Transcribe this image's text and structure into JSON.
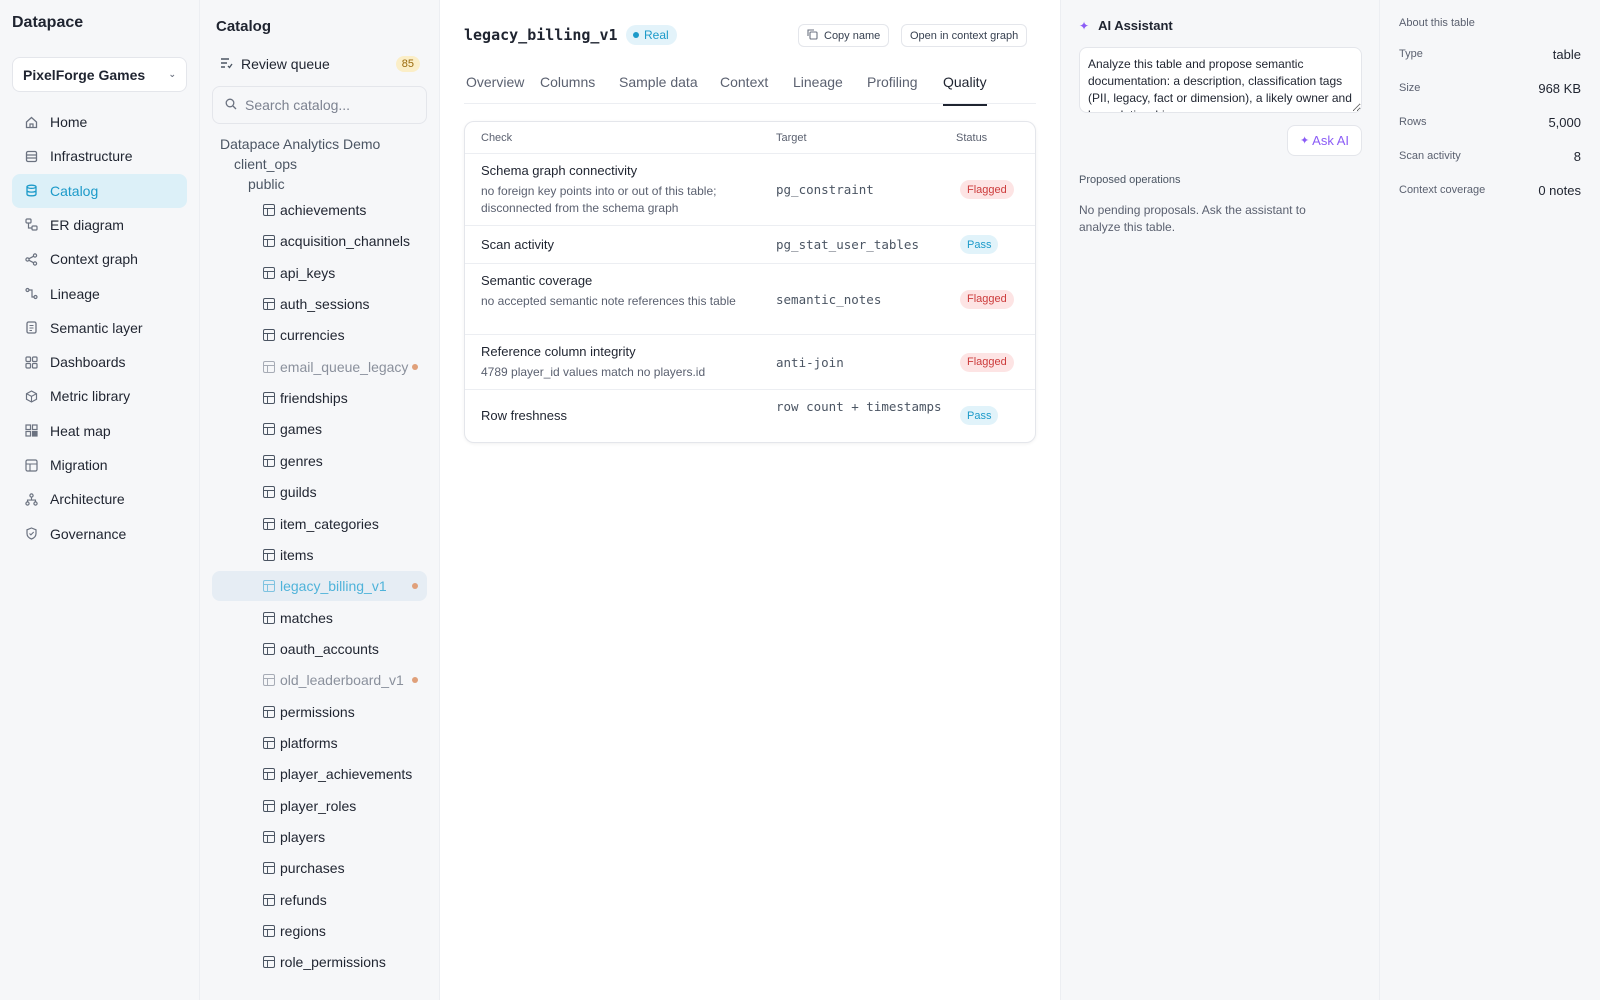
{
  "brand": "Datapace",
  "workspace": {
    "name": "PixelForge Games"
  },
  "nav": [
    {
      "label": "Home",
      "icon": "home-icon"
    },
    {
      "label": "Infrastructure",
      "icon": "server-icon"
    },
    {
      "label": "Catalog",
      "icon": "database-icon",
      "active": true
    },
    {
      "label": "ER diagram",
      "icon": "er-diagram-icon"
    },
    {
      "label": "Context graph",
      "icon": "share-graph-icon"
    },
    {
      "label": "Lineage",
      "icon": "lineage-icon"
    },
    {
      "label": "Semantic layer",
      "icon": "document-icon"
    },
    {
      "label": "Dashboards",
      "icon": "grid-icon"
    },
    {
      "label": "Metric library",
      "icon": "cube-icon"
    },
    {
      "label": "Heat map",
      "icon": "heatmap-icon"
    },
    {
      "label": "Migration",
      "icon": "migration-icon"
    },
    {
      "label": "Architecture",
      "icon": "architecture-icon"
    },
    {
      "label": "Governance",
      "icon": "shield-icon"
    }
  ],
  "catalog": {
    "title": "Catalog",
    "review_queue": {
      "label": "Review queue",
      "count": "85"
    },
    "search_placeholder": "Search catalog...",
    "database": "Datapace Analytics Demo",
    "schema": "client_ops",
    "subschema": "public",
    "tables": [
      {
        "name": "achievements"
      },
      {
        "name": "acquisition_channels"
      },
      {
        "name": "api_keys"
      },
      {
        "name": "auth_sessions"
      },
      {
        "name": "currencies"
      },
      {
        "name": "email_queue_legacy",
        "muted": true,
        "dot": true
      },
      {
        "name": "friendships"
      },
      {
        "name": "games"
      },
      {
        "name": "genres"
      },
      {
        "name": "guilds"
      },
      {
        "name": "item_categories"
      },
      {
        "name": "items"
      },
      {
        "name": "legacy_billing_v1",
        "muted": true,
        "dot": true,
        "selected": true
      },
      {
        "name": "matches"
      },
      {
        "name": "oauth_accounts"
      },
      {
        "name": "old_leaderboard_v1",
        "muted": true,
        "dot": true
      },
      {
        "name": "permissions"
      },
      {
        "name": "platforms"
      },
      {
        "name": "player_achievements"
      },
      {
        "name": "player_roles"
      },
      {
        "name": "players"
      },
      {
        "name": "purchases"
      },
      {
        "name": "refunds"
      },
      {
        "name": "regions"
      },
      {
        "name": "role_permissions"
      }
    ]
  },
  "main": {
    "table_name": "legacy_billing_v1",
    "badge": "Real",
    "copy_label": "Copy name",
    "context_label": "Open in context graph",
    "tabs": [
      "Overview",
      "Columns",
      "Sample data",
      "Context",
      "Lineage",
      "Profiling",
      "Quality"
    ],
    "active_tab": "Quality",
    "quality": {
      "headers": {
        "check": "Check",
        "target": "Target",
        "status": "Status"
      },
      "rows": [
        {
          "title": "Schema graph connectivity",
          "desc": "no foreign key points into or out of this table; disconnected from the schema graph",
          "target": "pg_constraint",
          "status": "Flagged"
        },
        {
          "title": "Scan activity",
          "desc": "",
          "target": "pg_stat_user_tables",
          "status": "Pass"
        },
        {
          "title": "Semantic coverage",
          "desc": "no accepted semantic note references this table",
          "target": "semantic_notes",
          "status": "Flagged"
        },
        {
          "title": "Reference column integrity",
          "desc": "4789 player_id values match no players.id",
          "target": "anti-join",
          "status": "Flagged"
        },
        {
          "title": "Row freshness",
          "desc": "",
          "target": "row count + timestamps",
          "status": "Pass"
        }
      ]
    }
  },
  "ai": {
    "title": "AI Assistant",
    "prompt": "Analyze this table and propose semantic documentation: a description, classification tags (PII, legacy, fact or dimension), a likely owner and key relationships.",
    "ask_label": "Ask AI",
    "proposed_title": "Proposed operations",
    "proposed_empty": "No pending proposals. Ask the assistant to analyze this table."
  },
  "about": {
    "title": "About this table",
    "rows": [
      {
        "key": "Type",
        "value": "table"
      },
      {
        "key": "Size",
        "value": "968 KB"
      },
      {
        "key": "Rows",
        "value": "5,000"
      },
      {
        "key": "Scan activity",
        "value": "8"
      },
      {
        "key": "Context coverage",
        "value": "0 notes"
      }
    ]
  },
  "colors": {
    "accent": "#1c9ac9",
    "ai": "#8b5cf6",
    "flagged": "#cc3b3b",
    "warning_dot": "#e0a07a"
  }
}
